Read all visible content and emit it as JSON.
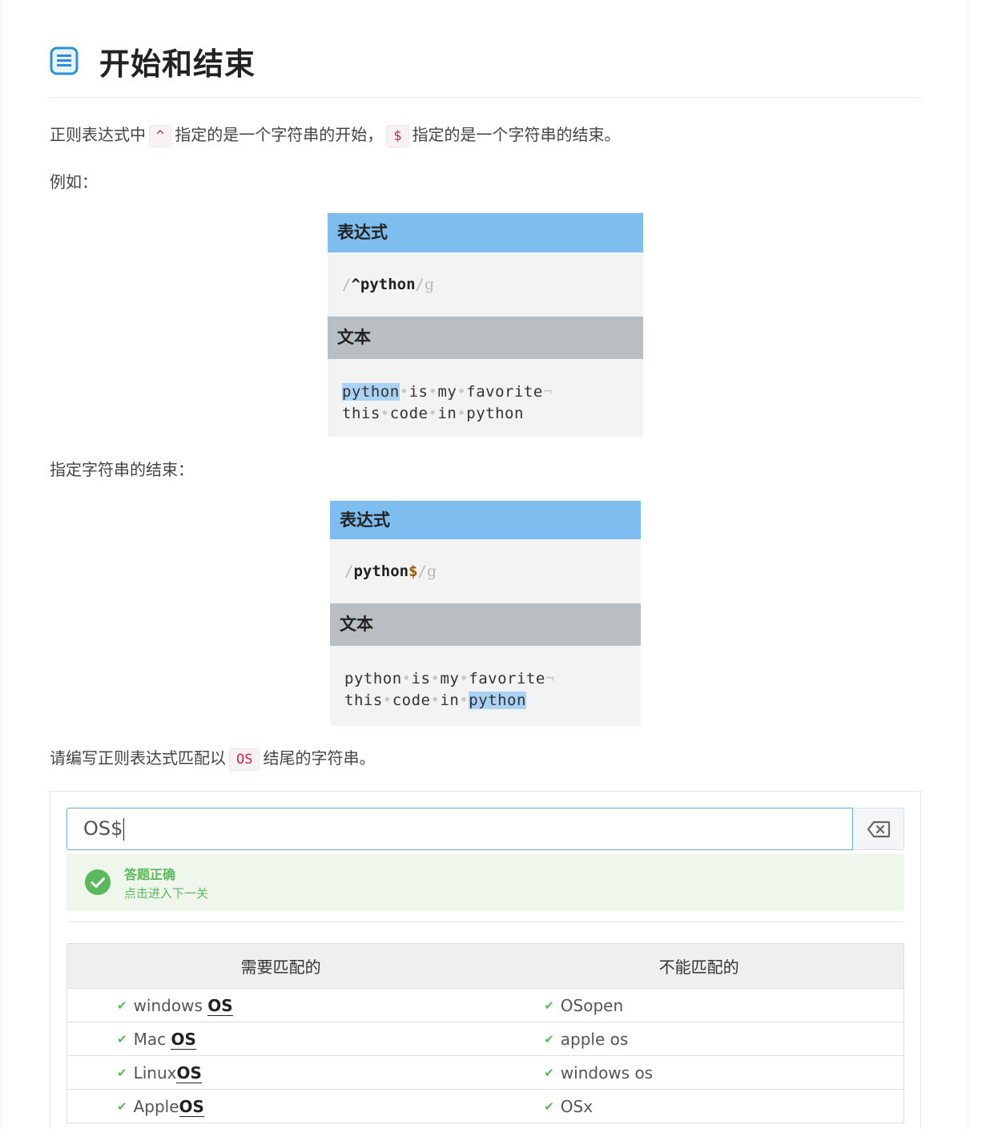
{
  "title": "开始和结束",
  "intro": {
    "before": "正则表达式中",
    "caret_code": "^",
    "middle": "指定的是一个字符串的开始，",
    "dollar_code": "$",
    "after": "指定的是一个字符串的结束。"
  },
  "example_label": "例如：",
  "example1": {
    "expr_header": "表达式",
    "slash_open": "/",
    "anchor": "^",
    "pattern": "python",
    "slash_close": "/",
    "flag": "g",
    "text_header": "文本",
    "line1": [
      "python",
      "is",
      "my",
      "favorite"
    ],
    "line2": [
      "this",
      "code",
      "in",
      "python"
    ],
    "end_mark": "¬",
    "sep": "•"
  },
  "end_label": "指定字符串的结束：",
  "example2": {
    "expr_header": "表达式",
    "slash_open": "/",
    "pattern": "python",
    "anchor": "$",
    "slash_close": "/",
    "flag": "g",
    "text_header": "文本",
    "line1": [
      "python",
      "is",
      "my",
      "favorite"
    ],
    "line2": [
      "this",
      "code",
      "in",
      "python"
    ],
    "end_mark": "¬",
    "sep": "•"
  },
  "task": {
    "before": "请编写正则表达式匹配以",
    "code": "OS",
    "after": "结尾的字符串。"
  },
  "exercise": {
    "input_value": "OS$",
    "clear_icon": "backspace-icon",
    "success_title": "答题正确",
    "success_link": "点击进入下一关",
    "col_match": "需要匹配的",
    "col_nomatch": "不能匹配的",
    "rows": [
      {
        "match_pre": "windows ",
        "match_hl": "OS",
        "nomatch": "OSopen"
      },
      {
        "match_pre": "Mac ",
        "match_hl": "OS",
        "nomatch": "apple os"
      },
      {
        "match_pre": "Linux",
        "match_hl": "OS",
        "nomatch": "windows os"
      },
      {
        "match_pre": "Apple",
        "match_hl": "OS",
        "nomatch": "OSx"
      }
    ],
    "check_glyph": "✔"
  },
  "colors": {
    "accent_blue": "#7ebdef",
    "success_green": "#5cb85c",
    "code_red": "#c7254e"
  }
}
